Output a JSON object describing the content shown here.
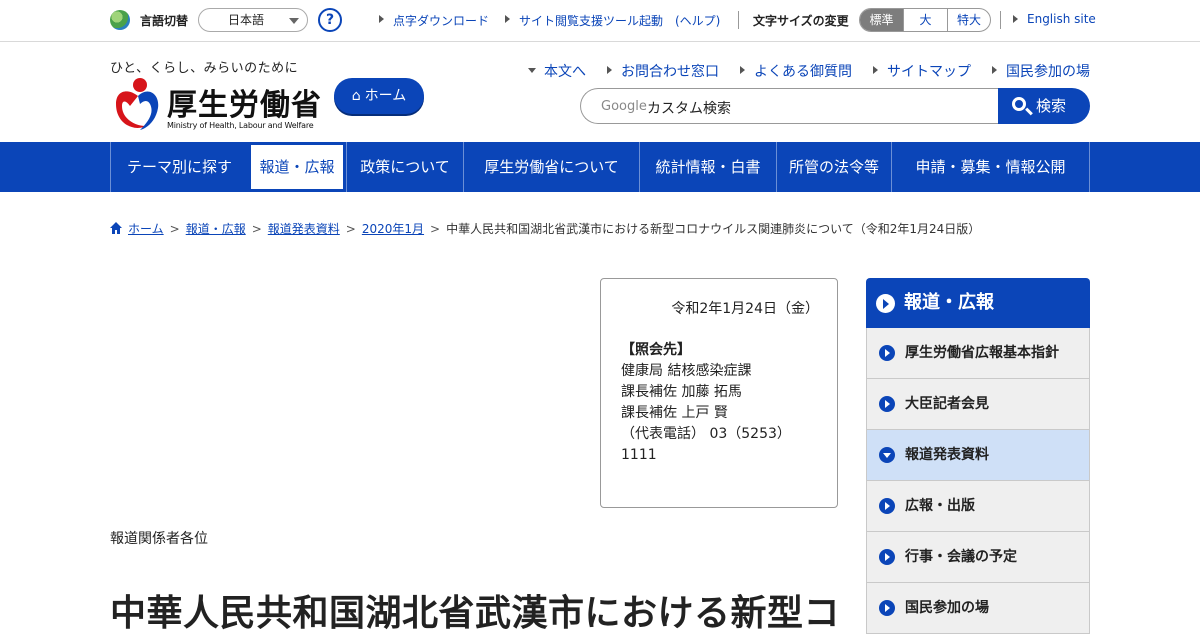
{
  "utility": {
    "language_label": "言語切替",
    "language_selected": "日本語",
    "help_label": "?",
    "links": [
      "点字ダウンロード",
      "サイト閲覧支援ツール起動　(ヘルプ)"
    ],
    "font_size_label": "文字サイズの変更",
    "font_sizes": [
      "標準",
      "大",
      "特大"
    ],
    "font_size_active": "標準",
    "english_link": "English site"
  },
  "header": {
    "tagline": "ひと、くらし、みらいのために",
    "logo_text": "厚生労働省",
    "logo_en": "Ministry of Health, Labour and Welfare",
    "home_button": "ホーム",
    "links": [
      "本文へ",
      "お問合わせ窓口",
      "よくある御質問",
      "サイトマップ",
      "国民参加の場"
    ],
    "search_brand": "Google",
    "search_placeholder": "カスタム検索",
    "search_button": "検索"
  },
  "gnav": {
    "items": [
      "テーマ別に探す",
      "報道・広報",
      "政策について",
      "厚生労働省について",
      "統計情報・白書",
      "所管の法令等",
      "申請・募集・情報公開"
    ],
    "active": "報道・広報"
  },
  "breadcrumb": {
    "links": [
      "ホーム",
      "報道・広報",
      "報道発表資料",
      "2020年1月"
    ],
    "separator": ">",
    "current": "中華人民共和国湖北省武漢市における新型コロナウイルス関連肺炎について（令和2年1月24日版）"
  },
  "contact": {
    "date": "令和2年1月24日（金）",
    "title": "【照会先】",
    "lines": [
      "健康局 結核感染症課",
      "課長補佐 加藤 拓馬",
      "課長補佐 上戸 賢",
      "（代表電話） 03（5253）1111"
    ]
  },
  "main": {
    "addressee": "報道関係者各位",
    "title": "中華人民共和国湖北省武漢市における新型コ"
  },
  "sidenav": {
    "heading": "報道・広報",
    "items": [
      "厚生労働省広報基本指針",
      "大臣記者会見",
      "報道発表資料",
      "広報・出版",
      "行事・会議の予定",
      "国民参加の場"
    ],
    "current": "報道発表資料"
  },
  "colors": {
    "brand_blue": "#0b45b8",
    "current_item_bg": "#cfe0f7"
  }
}
